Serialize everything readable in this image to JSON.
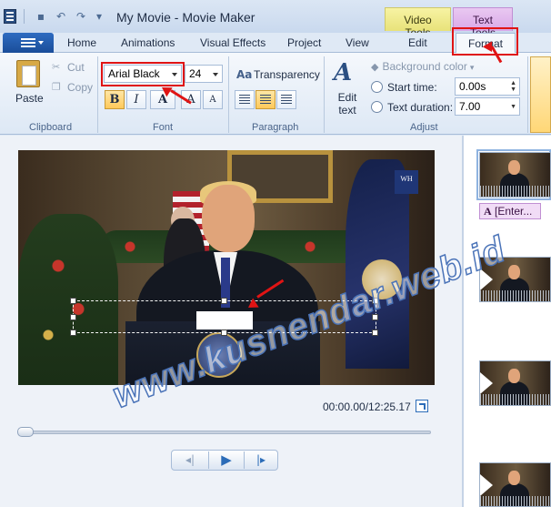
{
  "window": {
    "title": "My Movie - Movie Maker"
  },
  "context_tabs": {
    "video_tools": "Video Tools",
    "text_tools": "Text Tools"
  },
  "tabs": [
    "Home",
    "Animations",
    "Visual Effects",
    "Project",
    "View",
    "Edit",
    "Format"
  ],
  "active_tab": "Format",
  "clipboard": {
    "paste": "Paste",
    "cut": "Cut",
    "copy": "Copy",
    "group": "Clipboard"
  },
  "font": {
    "family": "Arial Black",
    "size": "24",
    "bold": "B",
    "italic": "I",
    "color": "A",
    "grow": "A",
    "shrink": "A",
    "group": "Font"
  },
  "paragraph": {
    "transparency": "Transparency",
    "group": "Paragraph"
  },
  "adjust": {
    "edit_text": "Edit text",
    "background_color": "Background color",
    "start_time_label": "Start time:",
    "start_time_value": "0.00s",
    "text_duration_label": "Text duration:",
    "text_duration_value": "7.00",
    "group": "Adjust"
  },
  "player": {
    "timecode": "00:00.00/12:25.17",
    "seek_fraction": 0.0
  },
  "preview": {
    "wh_badge": "WH"
  },
  "storyboard": {
    "caption": "[Enter..."
  },
  "watermark": "www.kusnendar.web.id",
  "colors": {
    "highlight": "#e01414",
    "format_tab_accent": "#c08fd3",
    "video_tools_accent": "#e8e27a"
  }
}
